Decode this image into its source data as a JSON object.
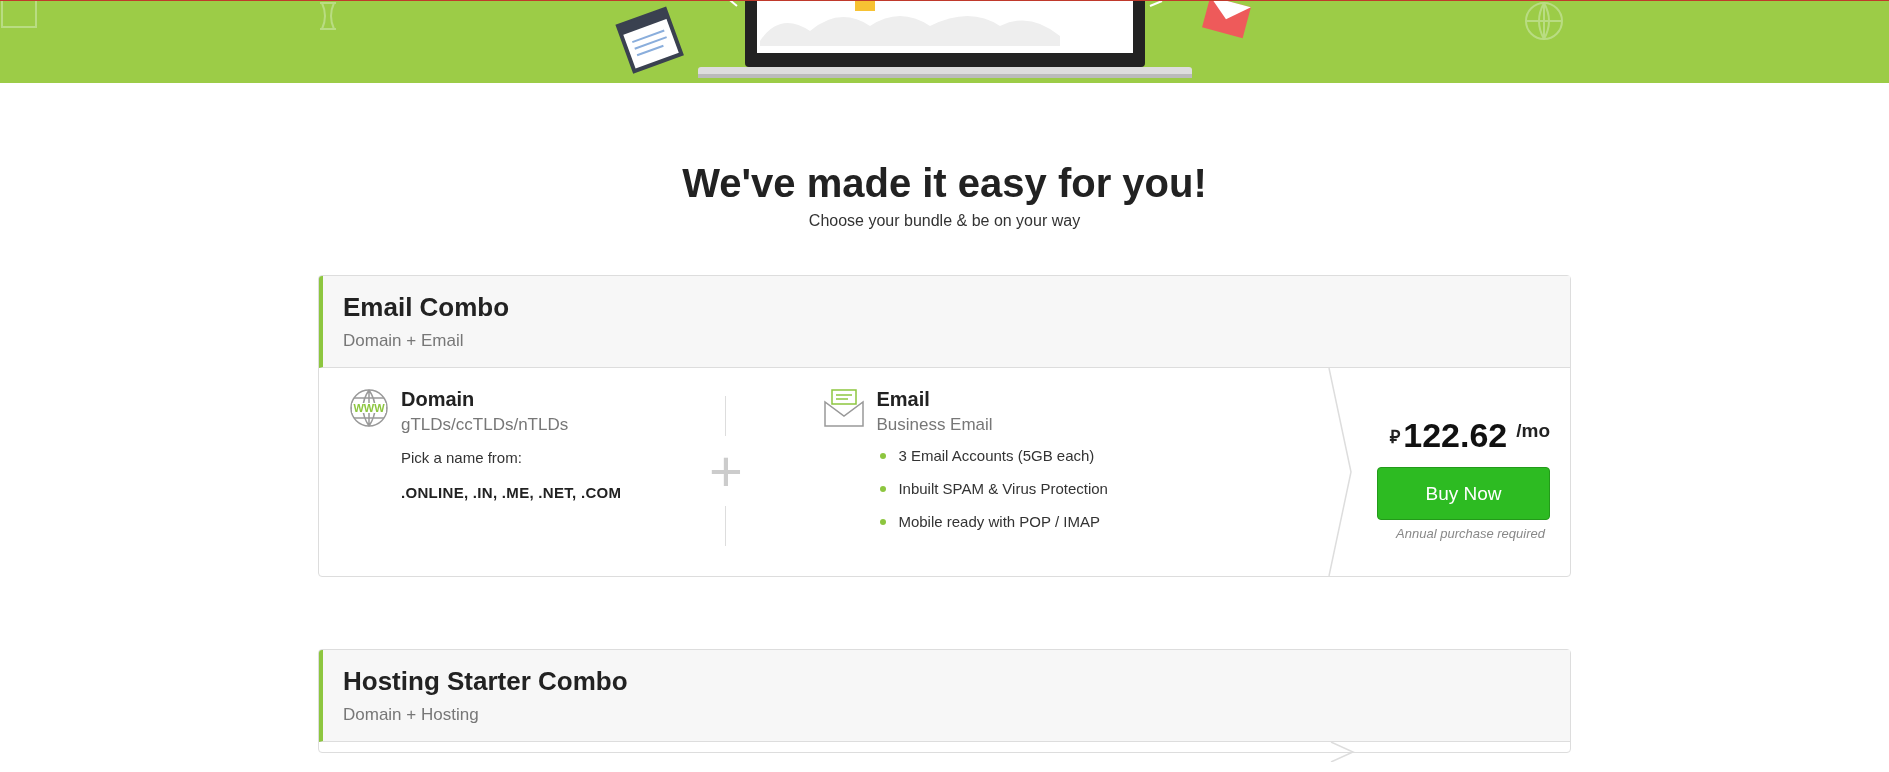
{
  "heading": {
    "title": "We've made it easy for you!",
    "subtitle": "Choose your bundle & be on your way"
  },
  "bundles": [
    {
      "title": "Email Combo",
      "subtitle": "Domain + Email",
      "domain": {
        "icon_label": "WWW",
        "name": "Domain",
        "type": "gTLDs/ccTLDs/nTLDs",
        "pick_label": "Pick a name from:",
        "extensions": ".ONLINE, .IN, .ME, .NET, .COM"
      },
      "plus": "+",
      "email": {
        "name": "Email",
        "type": "Business Email",
        "features": [
          "3 Email Accounts (5GB each)",
          "Inbuilt SPAM & Virus Protection",
          "Mobile ready with POP / IMAP"
        ]
      },
      "price": {
        "currency": "₽",
        "amount": "122.62",
        "period": "/mo",
        "button": "Buy Now",
        "note": "Annual purchase required"
      }
    },
    {
      "title": "Hosting Starter Combo",
      "subtitle": "Domain + Hosting"
    }
  ]
}
